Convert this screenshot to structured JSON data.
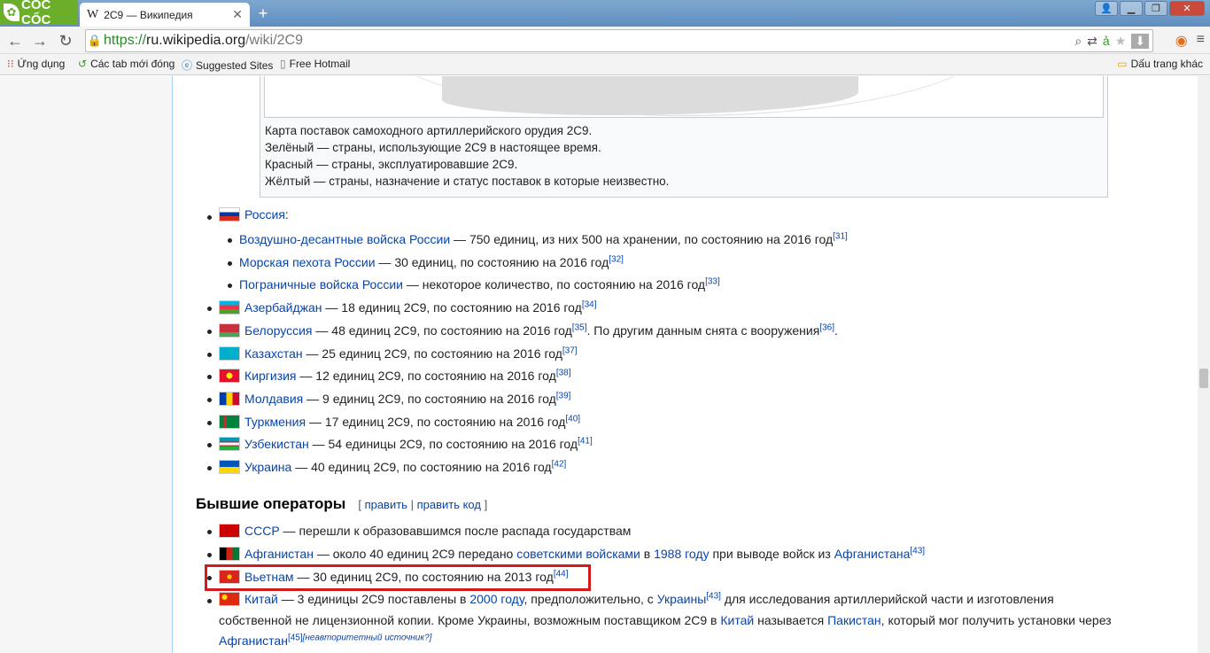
{
  "browser": {
    "logo_text": "CỐC CỐC",
    "tab_title": "2С9 — Википедия",
    "tab_close": "✕",
    "new_tab": "+",
    "url_scheme": "https://",
    "url_host": "ru.wikipedia.org",
    "url_path": "/wiki/2C9",
    "bookmarks": [
      {
        "label": "Ứng dụng",
        "icon": "apps-grid-icon"
      },
      {
        "label": "Các tab mới đóng",
        "icon": "history-icon"
      },
      {
        "label": "Suggested Sites",
        "icon": "ie-icon"
      },
      {
        "label": "Free Hotmail",
        "icon": "page-icon"
      }
    ],
    "bookmarks_folder": "Dấu trang khác"
  },
  "thumb": {
    "caption": [
      "Карта поставок самоходного артиллерийского орудия 2С9.",
      "Зелёный — страны, использующие 2С9 в настоящее время.",
      "Красный — страны, эксплуатировавшие 2С9.",
      "Жёлтый — страны, назначение и статус поставок в которые неизвестно."
    ]
  },
  "current": {
    "russia": {
      "link": "Россия",
      "suffix": ":"
    },
    "russia_sub": [
      {
        "link": "Воздушно-десантные войска России",
        "text": " — 750 единиц, из них 500 на хранении, по состоянию на 2016 год",
        "ref": "[31]"
      },
      {
        "link": "Морская пехота России",
        "text": " — 30 единиц, по состоянию на 2016 год",
        "ref": "[32]"
      },
      {
        "link": "Пограничные войска России",
        "text": " — некоторое количество, по состоянию на 2016 год",
        "ref": "[33]"
      }
    ],
    "countries": [
      {
        "link": "Азербайджан",
        "text": " — 18 единиц 2С9, по состоянию на 2016 год",
        "ref": "[34]",
        "extra": "",
        "ref2": "",
        "end": ""
      },
      {
        "link": "Белоруссия",
        "text": " — 48 единиц 2С9, по состоянию на 2016 год",
        "ref": "[35]",
        "extra": ". По другим данным снята с вооружения",
        "ref2": "[36]",
        "end": "."
      },
      {
        "link": "Казахстан",
        "text": " — 25 единиц 2С9, по состоянию на 2016 год",
        "ref": "[37]",
        "extra": "",
        "ref2": "",
        "end": ""
      },
      {
        "link": "Киргизия",
        "text": " — 12 единиц 2С9, по состоянию на 2016 год",
        "ref": "[38]",
        "extra": "",
        "ref2": "",
        "end": ""
      },
      {
        "link": "Молдавия",
        "text": " — 9 единиц 2С9, по состоянию на 2016 год",
        "ref": "[39]",
        "extra": "",
        "ref2": "",
        "end": ""
      },
      {
        "link": "Туркмения",
        "text": " — 17 единиц 2С9, по состоянию на 2016 год",
        "ref": "[40]",
        "extra": "",
        "ref2": "",
        "end": ""
      },
      {
        "link": "Узбекистан",
        "text": " — 54 единицы 2С9, по состоянию на 2016 год",
        "ref": "[41]",
        "extra": "",
        "ref2": "",
        "end": ""
      },
      {
        "link": "Украина",
        "text": " — 40 единиц 2С9, по состоянию на 2016 год",
        "ref": "[42]",
        "extra": "",
        "ref2": "",
        "end": ""
      }
    ]
  },
  "former": {
    "heading": "Бывшие операторы",
    "edit_open": "[ ",
    "edit_link": "править",
    "edit_sep": " | ",
    "edit_code": "править код",
    "edit_close": " ]",
    "ussr": {
      "link": "СССР",
      "text": " — перешли к образовавшимся после распада государствам"
    },
    "afghanistan": {
      "link": "Афганистан",
      "t1": " — около 40 единиц 2С9 передано ",
      "l2": "советскими войсками",
      "t2": " в ",
      "l3": "1988 году",
      "t3": " при выводе войск из ",
      "l4": "Афганистана",
      "ref": "[43]"
    },
    "vietnam": {
      "link": "Вьетнам",
      "text": " — 30 единиц 2С9, по состоянию на 2013 год",
      "ref": "[44]"
    },
    "china": {
      "link": "Китай",
      "t1": " — 3 единицы 2С9 поставлены в ",
      "l2": "2000 году",
      "t2": ", предположительно, с ",
      "l3": "Украины",
      "ref": "[43]",
      "t3": " для исследования артиллерийской части и изготовления",
      "line2": "собственной не лицензионной копии. Кроме Украины, возможным поставщиком 2С9 в ",
      "l4": "Китай",
      "t4": " называется ",
      "l5": "Пакистан",
      "t5": ", который мог получить установки через",
      "l6": "Афганистан",
      "ref2": "[45]",
      "note": "[неавторитетный источник?]"
    }
  },
  "colors": {
    "link": "#0645ad",
    "highlight": "#d21a1a",
    "tabbar": "#6f9ac6"
  }
}
